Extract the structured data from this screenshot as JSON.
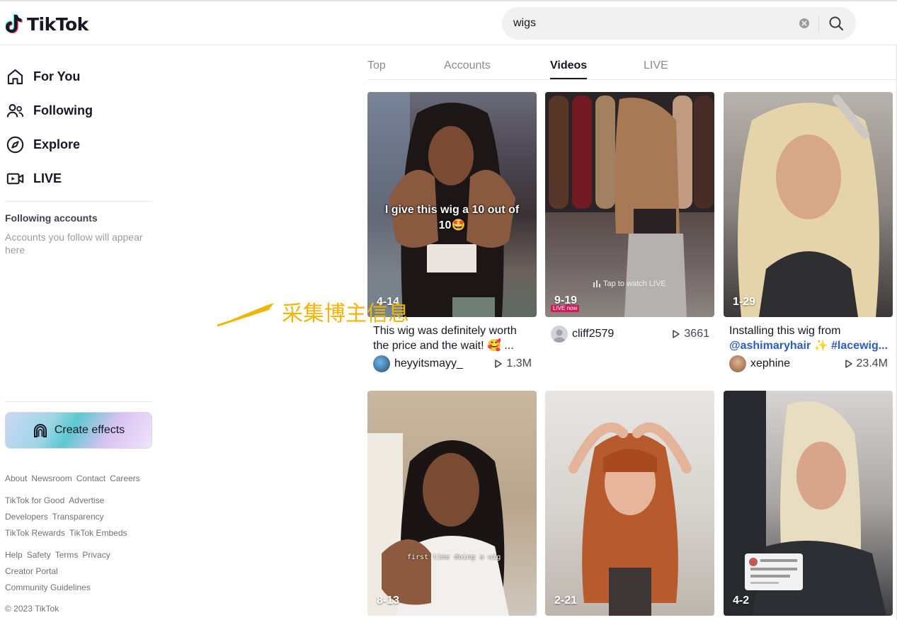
{
  "brand": {
    "name": "TikTok"
  },
  "search": {
    "value": "wigs",
    "clear_icon": "clear-circle-icon",
    "search_icon": "search-icon"
  },
  "nav": [
    {
      "label": "For You",
      "icon": "home-icon"
    },
    {
      "label": "Following",
      "icon": "people-icon"
    },
    {
      "label": "Explore",
      "icon": "compass-icon"
    },
    {
      "label": "LIVE",
      "icon": "live-camera-icon"
    }
  ],
  "following": {
    "title": "Following accounts",
    "empty": "Accounts you follow will appear here"
  },
  "create_effects": {
    "label": "Create effects"
  },
  "footer": {
    "row1": [
      "About",
      "Newsroom",
      "Contact",
      "Careers"
    ],
    "row2": [
      "TikTok for Good",
      "Advertise"
    ],
    "row3": [
      "Developers",
      "Transparency"
    ],
    "row4": [
      "TikTok Rewards",
      "TikTok Embeds"
    ],
    "row5": [
      "Help",
      "Safety",
      "Terms",
      "Privacy"
    ],
    "row6": [
      "Creator Portal"
    ],
    "row7": [
      "Community Guidelines"
    ],
    "copyright": "© 2023 TikTok"
  },
  "tabs": [
    {
      "label": "Top",
      "active": false
    },
    {
      "label": "Accounts",
      "active": false
    },
    {
      "label": "Videos",
      "active": true
    },
    {
      "label": "LIVE",
      "active": false
    }
  ],
  "videos": [
    {
      "date": "4-14",
      "overlay": "I give this wig a 10 out of 10🤩",
      "caption": "This wig was definitely worth the price and the wait! 🥰 ...",
      "author": "heyyitsmayy_",
      "views": "1.3M"
    },
    {
      "date": "9-19",
      "live_badge": "LIVE now",
      "tap_text": "Tap to watch LIVE",
      "author": "cliff2579",
      "views": "3661"
    },
    {
      "date": "1-29",
      "caption_plain": "Installing this wig from",
      "caption_tags": "@ashimaryhair ✨ #lacewig...",
      "author": "xephine",
      "views": "23.4M"
    },
    {
      "date": "8-13",
      "overlay": "first time doing a wig"
    },
    {
      "date": "2-21"
    },
    {
      "date": "4-2",
      "comment": "Reply to comment"
    }
  ],
  "annotation": {
    "text": "采集博主信息",
    "color": "#f2b407"
  }
}
